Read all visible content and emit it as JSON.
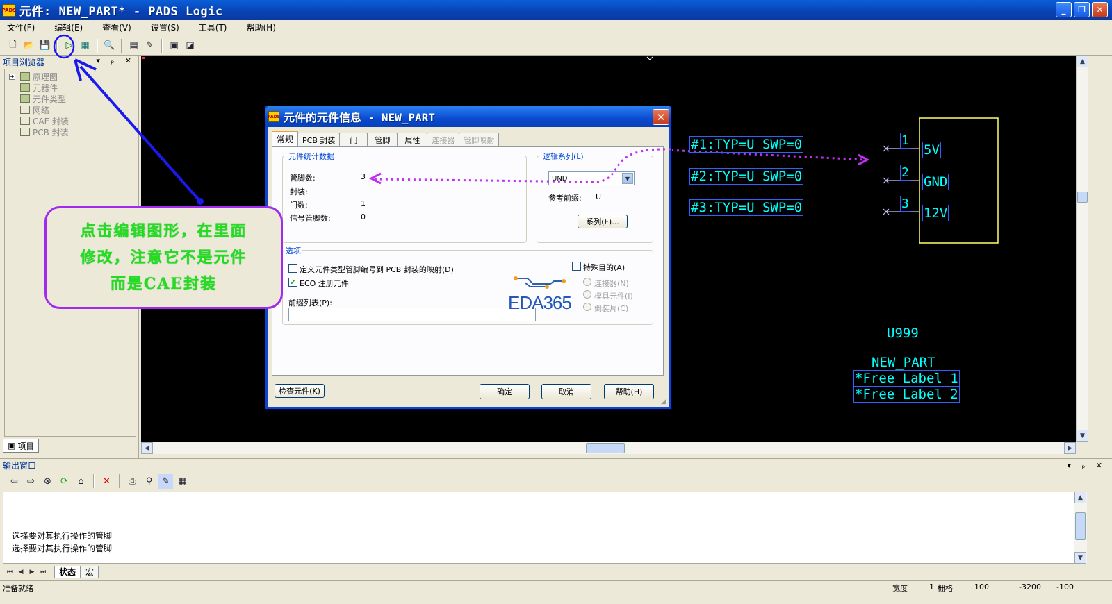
{
  "window": {
    "title": "元件: NEW_PART* - PADS Logic",
    "app_icon_text": "PADS",
    "minimize": "_",
    "restore": "❐",
    "close": "✕"
  },
  "menu": [
    "文件(F)",
    "编辑(E)",
    "查看(V)",
    "设置(S)",
    "工具(T)",
    "帮助(H)"
  ],
  "project_panel": {
    "title": "项目浏览器",
    "controls": "▾ ₚ ✕",
    "tree": [
      "原理图",
      "元器件",
      "元件类型",
      "网络",
      "CAE 封装",
      "PCB 封装"
    ],
    "bottom_tab": "项目"
  },
  "schematic": {
    "pin_attrs": [
      "#1:TYP=U SWP=0",
      "#2:TYP=U SWP=0",
      "#3:TYP=U SWP=0"
    ],
    "pins": [
      {
        "number": "1",
        "name": "5V"
      },
      {
        "number": "2",
        "name": "GND"
      },
      {
        "number": "3",
        "name": "12V"
      }
    ],
    "ref_des": "U999",
    "part_name": "NEW_PART",
    "free_labels": [
      "*Free Label 1",
      "*Free Label 2"
    ],
    "colors": {
      "text": "#00ffff",
      "outline": "#ffff66",
      "pin": "#c8c8ff",
      "background": "#000000"
    }
  },
  "dialog": {
    "title": "元件的元件信息 - NEW_PART",
    "app_icon_text": "PADS",
    "close": "✕",
    "tabs": [
      {
        "label": "常规",
        "state": "active"
      },
      {
        "label": "PCB 封装",
        "state": "normal"
      },
      {
        "label": "门",
        "state": "normal"
      },
      {
        "label": "管脚",
        "state": "normal"
      },
      {
        "label": "属性",
        "state": "normal"
      },
      {
        "label": "连接器",
        "state": "disabled"
      },
      {
        "label": "管脚映射",
        "state": "disabled"
      }
    ],
    "stats": {
      "title": "元件统计数据",
      "rows": [
        {
          "label": "管脚数:",
          "value": "3"
        },
        {
          "label": "封装:",
          "value": ""
        },
        {
          "label": "门数:",
          "value": "1"
        },
        {
          "label": "信号管脚数:",
          "value": "0"
        }
      ]
    },
    "logic_family": {
      "title": "逻辑系列(L)",
      "value": "UND",
      "prefix_label": "参考前缀:",
      "prefix_value": "U",
      "family_button": "系列(F)..."
    },
    "options": {
      "title": "选项",
      "define_mapping": {
        "label": "定义元件类型管脚编号到 PCB 封装的映射(D)",
        "checked": false
      },
      "eco_register": {
        "label": "ECO 注册元件",
        "checked": true
      },
      "prefix_list_label": "前缀列表(P):",
      "prefix_list_value": "",
      "special_purpose": {
        "label": "特殊目的(A)",
        "checked": false
      },
      "radios": [
        "连接器(N)",
        "模具元件(I)",
        "倒装片(C)"
      ]
    },
    "watermark": "EDA365",
    "buttons": {
      "check": "检查元件(K)",
      "ok": "确定",
      "cancel": "取消",
      "help": "帮助(H)"
    }
  },
  "annotation": {
    "lines": [
      "点击编辑图形，在里面",
      "修改，注意它不是元件",
      "而是CAE封装"
    ],
    "colors": {
      "text": "#22dd22",
      "border": "#a12aee",
      "arrow": "#1010ee",
      "dotted": "#c030f0"
    }
  },
  "output": {
    "title": "输出窗口",
    "controls": "▾ ₚ ✕",
    "messages": [
      "选择要对其执行操作的管脚",
      "选择要对其执行操作的管脚"
    ],
    "tabs": [
      "状态",
      "宏"
    ]
  },
  "status": {
    "left": "准备就绪",
    "width_label": "宽度",
    "width_value": "1",
    "grid_label": "栅格",
    "grid_value": "100",
    "x": "-3200",
    "y": "-100"
  }
}
